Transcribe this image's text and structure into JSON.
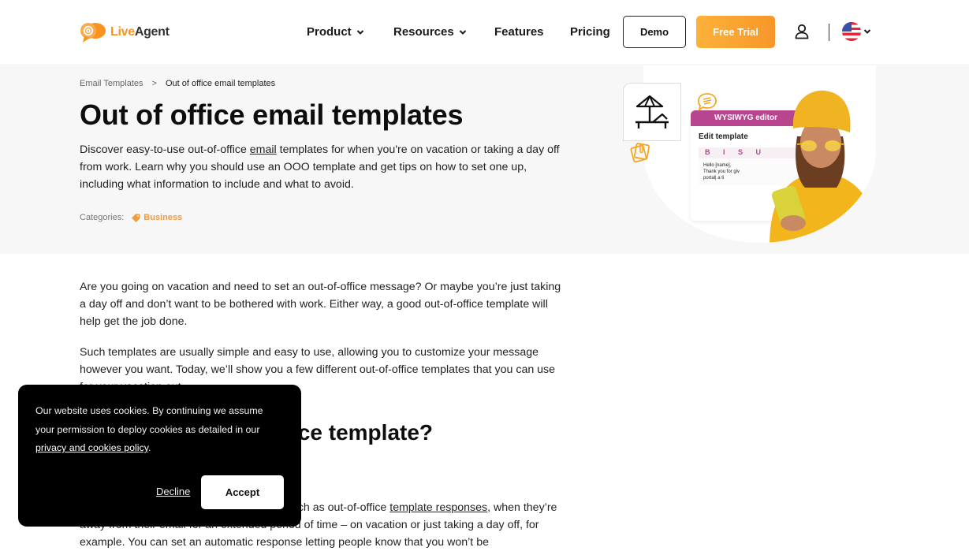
{
  "header": {
    "logo": {
      "live": "Live",
      "agent": "Agent"
    },
    "nav": [
      {
        "label": "Product",
        "has_dropdown": true
      },
      {
        "label": "Resources",
        "has_dropdown": true
      },
      {
        "label": "Features",
        "has_dropdown": false
      },
      {
        "label": "Pricing",
        "has_dropdown": false
      }
    ],
    "demo_label": "Demo",
    "trial_label": "Free Trial",
    "icons": {
      "user": "user-icon",
      "language": "us-flag-icon"
    }
  },
  "hero": {
    "breadcrumb": [
      {
        "label": "Email Templates"
      },
      {
        "separator": ">"
      },
      {
        "label": "Out of office email templates"
      }
    ],
    "title": "Out of office email templates",
    "description": {
      "before_link": "Discover easy-to-use out-of-office ",
      "link": "email",
      "after_link": " templates for when you're on vacation or taking a day off from work. Learn why you should use an OOO template and get tips on how to set one up, including what information to include and what to avoid."
    },
    "categories_label": "Categories:",
    "category": "Business",
    "illustration": {
      "editor_bar": "WYSIWYG editor",
      "editor_title": "Edit template",
      "toolbar": "B I S U",
      "body_lines": [
        "Hello [name],",
        "Thank you for giv",
        "portal| a ti"
      ]
    }
  },
  "content": {
    "paragraphs": [
      "Are you going on vacation and need to set an out-of-office message? Or maybe you’re just taking a day off and don’t want to be bothered with work. Either way, a good out-of-office template will help get the job done.",
      "Such templates are usually simple and easy to use, allowing you to customize your message however you want. Today, we’ll show you a few different out-of-office templates that you can use for your vacation out..."
    ],
    "section_heading": "What is an out of office template?",
    "section_paragraph": {
      "before_link": "Many people use email automation tools, such as out-of-office ",
      "link": "template responses",
      "after_link": ", when they’re away from their email for an extended period of time – on vacation or just taking a day off, for example. You can set an automatic response letting people know that you won’t be"
    }
  },
  "cookie_banner": {
    "text": "Our website uses cookies. By continuing we assume your permission to deploy cookies as detailed in our ",
    "link": "privacy and cookies policy",
    "text_end": ".",
    "decline_label": "Decline",
    "accept_label": "Accept"
  },
  "colors": {
    "brand_orange": "#f7941d",
    "trial_gradient_start": "#fdb23a",
    "trial_gradient_end": "#f7962a",
    "category_orange": "#f39a3a",
    "editor_purple": "#b8468f",
    "hero_bg": "#f7f7f7"
  }
}
